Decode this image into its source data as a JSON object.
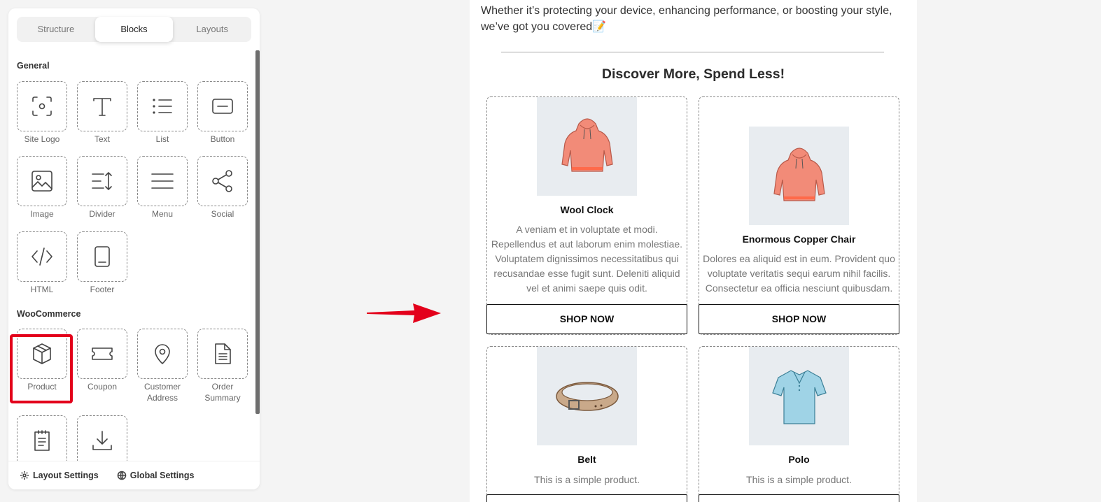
{
  "panel": {
    "tabs": [
      {
        "label": "Structure",
        "active": false
      },
      {
        "label": "Blocks",
        "active": true
      },
      {
        "label": "Layouts",
        "active": false
      }
    ],
    "sections": [
      {
        "title": "General",
        "blocks": [
          {
            "label": "Site Logo",
            "icon": "site-logo-icon"
          },
          {
            "label": "Text",
            "icon": "text-icon"
          },
          {
            "label": "List",
            "icon": "list-icon"
          },
          {
            "label": "Button",
            "icon": "button-icon"
          },
          {
            "label": "Image",
            "icon": "image-icon"
          },
          {
            "label": "Divider",
            "icon": "divider-icon"
          },
          {
            "label": "Menu",
            "icon": "menu-icon"
          },
          {
            "label": "Social",
            "icon": "share-icon"
          },
          {
            "label": "HTML",
            "icon": "code-icon"
          },
          {
            "label": "Footer",
            "icon": "footer-icon"
          }
        ]
      },
      {
        "title": "WooCommerce",
        "blocks": [
          {
            "label": "Product",
            "icon": "box-icon",
            "highlighted": true
          },
          {
            "label": "Coupon",
            "icon": "ticket-icon"
          },
          {
            "label": "Customer Address",
            "icon": "location-pin-icon"
          },
          {
            "label": "Order Summary",
            "icon": "document-icon"
          },
          {
            "label": "",
            "icon": "notepad-icon"
          },
          {
            "label": "",
            "icon": "download-icon"
          }
        ]
      }
    ],
    "footer": {
      "layout_settings": "Layout Settings",
      "global_settings": "Global Settings"
    },
    "highlight_color": "#e3001b"
  },
  "email": {
    "intro": "Whether it’s protecting your device, enhancing performance, or boosting your style, we’ve got you covered📝",
    "heading": "Discover More, Spend Less!",
    "products": [
      {
        "name": "Wool Clock",
        "description": "A veniam et in voluptate et modi. Repellendus et aut laborum enim molestiae. Voluptatem dignissimos necessitatibus qui recusandae esse fugit sunt. Deleniti aliquid vel et animi saepe quis odit.",
        "button": "SHOP NOW",
        "image": "hoodie-image"
      },
      {
        "name": "Enormous Copper Chair",
        "description": "Dolores ea aliquid est in eum. Provident quo voluptate veritatis sequi earum nihil facilis. Consectetur ea officia nesciunt quibusdam.",
        "button": "SHOP NOW",
        "image": "hoodie-image"
      },
      {
        "name": "Belt",
        "description": "This is a simple product.",
        "button": "",
        "image": "belt-image"
      },
      {
        "name": "Polo",
        "description": "This is a simple product.",
        "button": "",
        "image": "polo-shirt-image"
      }
    ]
  },
  "colors": {
    "arrow": "#e3001b",
    "hoodie": "#f28b78",
    "polo": "#9fd3e6",
    "belt": "#c9a98a"
  }
}
